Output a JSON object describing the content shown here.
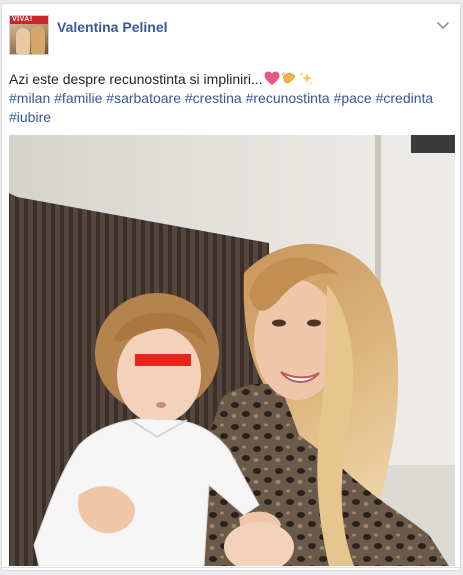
{
  "post": {
    "author": "Valentina Pelinel",
    "avatar_text": "VIVA!",
    "text": "Azi este despre recunostinta si impliniri...",
    "emojis": [
      "heart-emoji",
      "clapping-hands-emoji",
      "sparkles-emoji"
    ],
    "hashtags": [
      "#milan",
      "#familie",
      "#sarbatoare",
      "#crestina",
      "#recunostinta",
      "#pace",
      "#credinta",
      "#iubire"
    ]
  },
  "icons": {
    "options": "chevron-down-icon"
  },
  "colors": {
    "author_link": "#365899",
    "text": "#1d2129",
    "card_border": "#dddfe2",
    "censor_bar": "#e8241c"
  }
}
